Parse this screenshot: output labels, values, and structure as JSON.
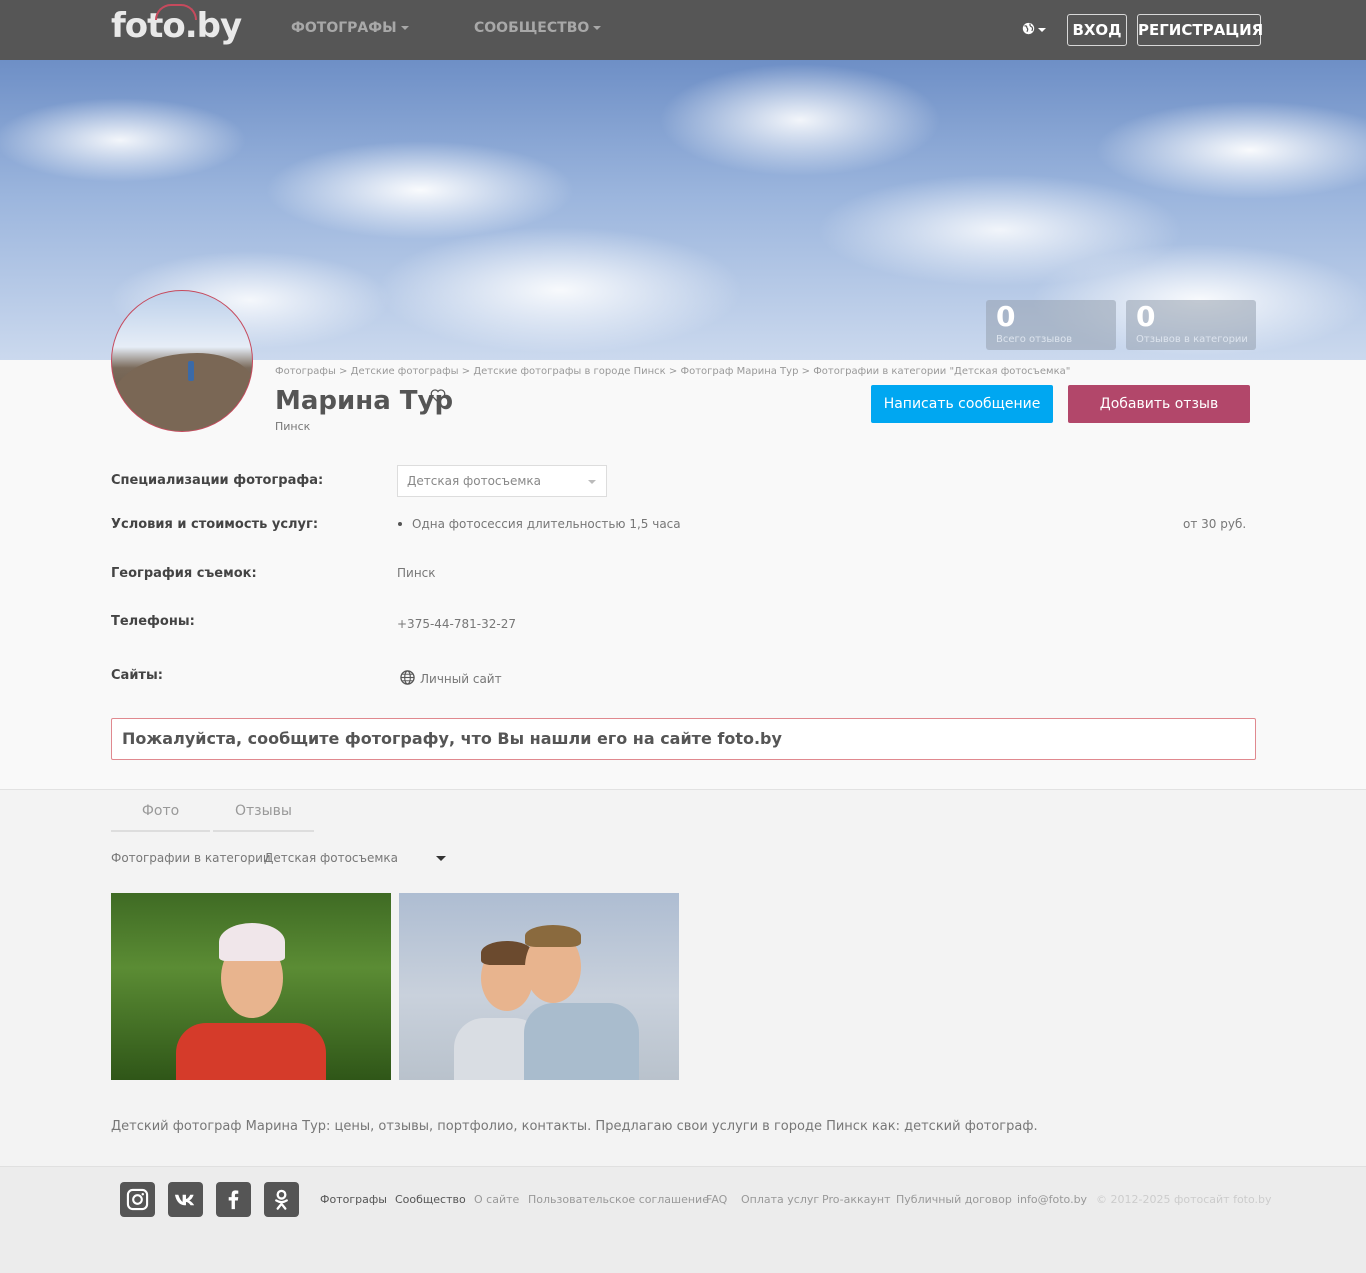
{
  "header": {
    "logo": "foto.by",
    "nav": [
      "ФОТОГРАФЫ",
      "СООБЩЕСТВО"
    ],
    "login": "ВХОД",
    "register": "РЕГИСТРАЦИЯ"
  },
  "stats": [
    {
      "value": "0",
      "label": "Всего отзывов"
    },
    {
      "value": "0",
      "label": "Отзывов в категории"
    }
  ],
  "breadcrumb": [
    "Фотографы",
    "Детские фотографы",
    "Детские фотографы в городе Пинск",
    "Фотограф Марина Тур",
    "Фотографии в категории \"Детская фотосъемка\""
  ],
  "breadcrumb_sep": ">",
  "profile": {
    "name": "Марина Тур",
    "city": "Пинск",
    "write_message": "Написать сообщение",
    "add_review": "Добавить отзыв"
  },
  "details": {
    "spec_label": "Специализации фотографа:",
    "spec_value": "Детская фотосъемка",
    "terms_label": "Условия и стоимость услуг:",
    "terms_item": "Одна фотосессия длительностью 1,5 часа",
    "terms_price": "от 30 руб.",
    "geo_label": "География съемок:",
    "geo_value": "Пинск",
    "phones_label": "Телефоны:",
    "phone": "+375-44-781-32-27",
    "sites_label": "Сайты:",
    "site": "Личный сайт"
  },
  "notice": "Пожалуйста, сообщите фотографу, что Вы нашли его на сайте foto.by",
  "tabs": [
    "Фото",
    "Отзывы"
  ],
  "category": {
    "label": "Фотографии в категории",
    "value": "Детская фотосъемка"
  },
  "description": "Детский фотограф Марина Тур: цены, отзывы, портфолио, контакты. Предлагаю свои услуги в городе Пинск как: детский фотограф.",
  "footer": {
    "social": [
      "instagram-icon",
      "vk-icon",
      "facebook-icon",
      "odnoklassniki-icon"
    ],
    "links": [
      "Фотографы",
      "Сообщество",
      "О сайте",
      "Пользовательское соглашение",
      "FAQ",
      "Оплата услуг",
      "Pro-аккаунт",
      "Публичный договор",
      "info@foto.by"
    ],
    "copyright": "© 2012-2025 фотосайт foto.by"
  },
  "colors": {
    "header_bg": "#565656",
    "primary_button": "#00a7f1",
    "review_button": "#b2476a",
    "accent": "#c64a5d"
  }
}
